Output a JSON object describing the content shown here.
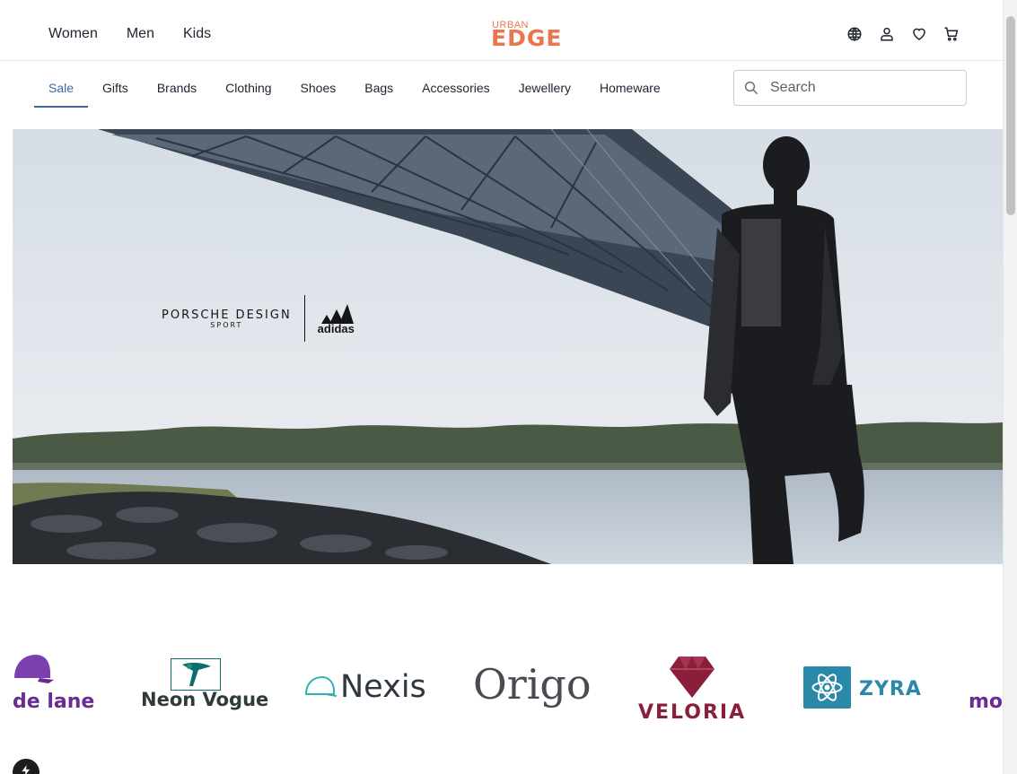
{
  "header": {
    "gender_nav": [
      {
        "label": "Women"
      },
      {
        "label": "Men"
      },
      {
        "label": "Kids"
      }
    ],
    "logo": {
      "top": "URBAN",
      "main": "EDGE",
      "color": "#e9764f"
    },
    "icons": [
      "globe-icon",
      "user-icon",
      "heart-icon",
      "cart-icon"
    ]
  },
  "categories": [
    {
      "label": "Sale",
      "active": true
    },
    {
      "label": "Gifts"
    },
    {
      "label": "Brands"
    },
    {
      "label": "Clothing"
    },
    {
      "label": "Shoes"
    },
    {
      "label": "Bags"
    },
    {
      "label": "Accessories"
    },
    {
      "label": "Jewellery"
    },
    {
      "label": "Homeware"
    }
  ],
  "search": {
    "placeholder": "Search",
    "value": ""
  },
  "hero": {
    "brand_left_line1": "PORSCHE DESIGN",
    "brand_left_line2": "SPORT",
    "brand_right": "adidas"
  },
  "brands": [
    {
      "name": "de lane"
    },
    {
      "name": "Neon Vogue"
    },
    {
      "name": "Nexis"
    },
    {
      "name": "Origo"
    },
    {
      "name": "VELORIA"
    },
    {
      "name": "ZYRA"
    },
    {
      "name": "mo"
    }
  ],
  "colors": {
    "accent": "#3b6aa0",
    "brand": "#e9764f"
  }
}
